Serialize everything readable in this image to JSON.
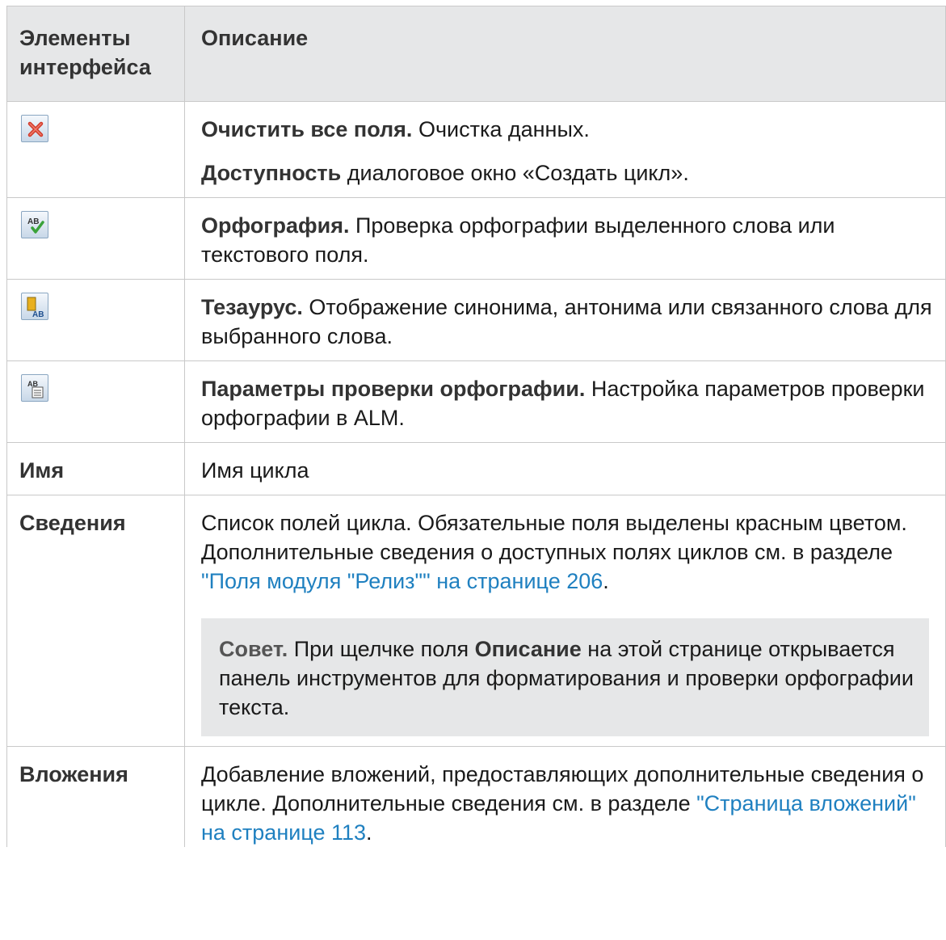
{
  "header": {
    "col1_line1": "Элементы",
    "col1_line2": "интерфейса",
    "col2": "Описание"
  },
  "rows": {
    "clear": {
      "icon": "red-x-clear-icon",
      "title": "Очистить все поля.",
      "text": " Очистка данных.",
      "avail_title": "Доступность",
      "avail_text": " диалоговое окно «Создать цикл»."
    },
    "spelling": {
      "icon": "spell-check-icon",
      "title": "Орфография.",
      "text": " Проверка орфографии выделенного слова или текстового поля."
    },
    "thesaurus": {
      "icon": "thesaurus-icon",
      "title": "Тезаурус.",
      "text": " Отображение синонима, антонима или связанного слова для выбранного слова."
    },
    "spell_options": {
      "icon": "spelling-options-icon",
      "title": "Параметры проверки орфографии.",
      "text": " Настройка параметров проверки орфографии в ALM."
    },
    "name": {
      "label": "Имя",
      "text": "Имя цикла"
    },
    "details": {
      "label": "Сведения",
      "text": "Список полей цикла. Обязательные поля выделены красным цветом. Дополнительные сведения о доступных полях циклов см. в разделе ",
      "link": "\"Поля модуля \"Релиз\"\" на странице 206",
      "after_link": ".",
      "tip_title": "Совет.",
      "tip_text1": " При щелчке поля ",
      "tip_bold": "Описание",
      "tip_text2": " на этой странице открывается панель инструментов для форматирования и проверки орфографии текста."
    },
    "attachments": {
      "label": "Вложения",
      "text": "Добавление вложений, предоставляющих дополнительные сведения о цикле. Дополнительные сведения см. в разделе ",
      "link": "\"Страница вложений\" на странице 113",
      "after_link": "."
    }
  },
  "colors": {
    "header_bg": "#e6e7e8",
    "link": "#1f80c0",
    "border": "#c9c9c9"
  }
}
